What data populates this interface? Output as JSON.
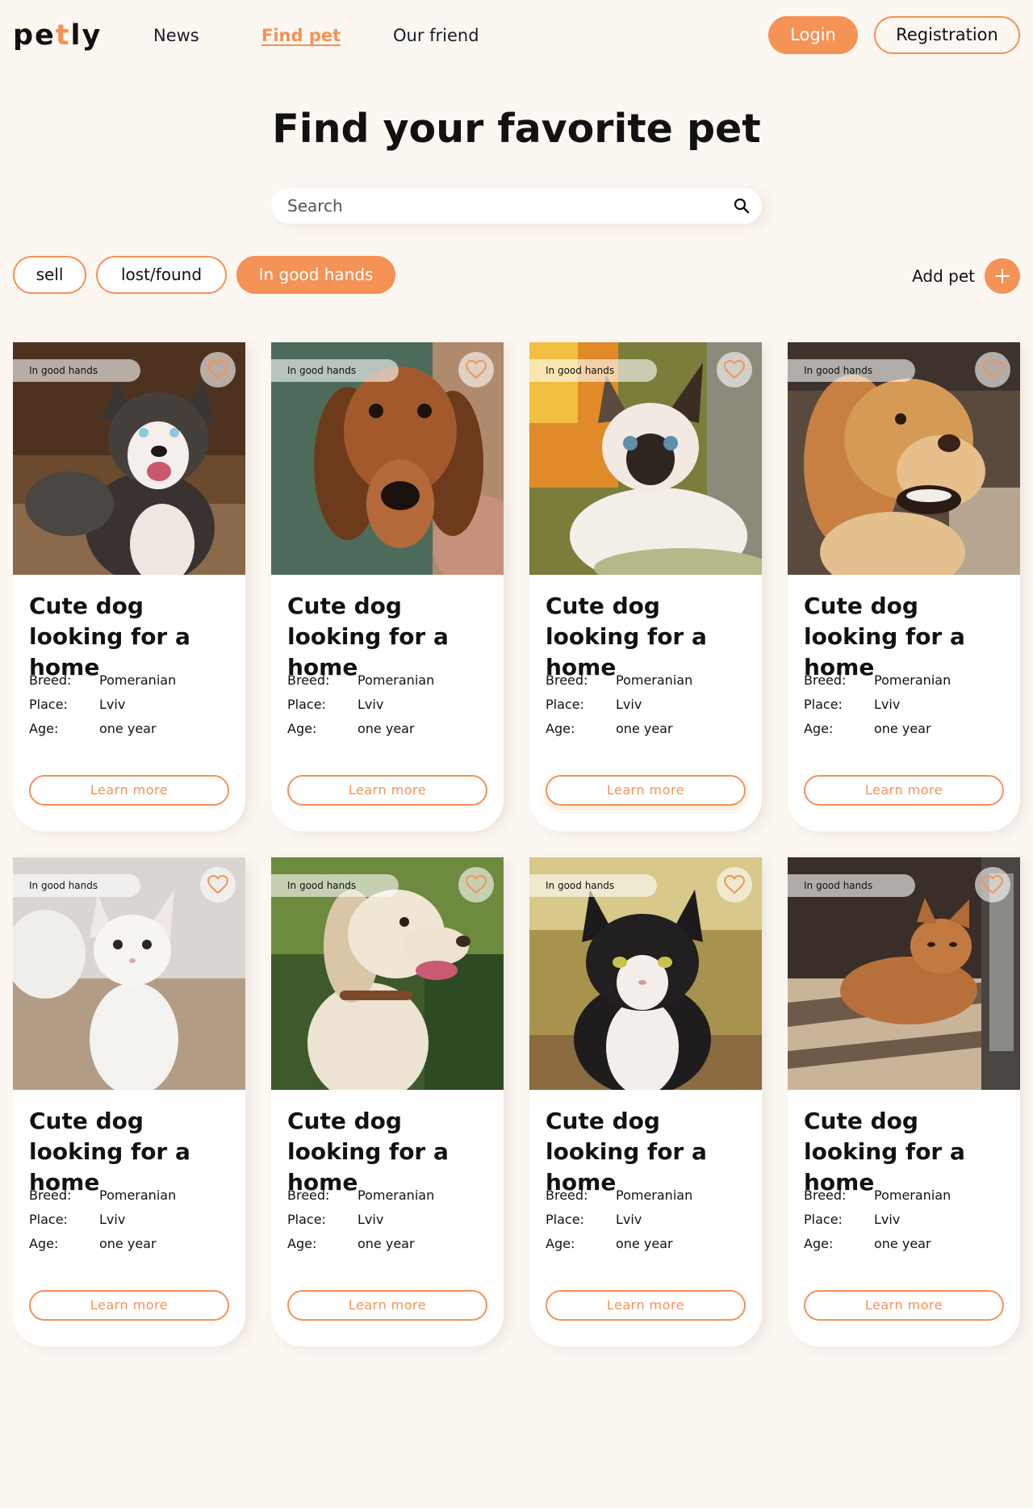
{
  "header": {
    "logo": {
      "part1": "pe",
      "part2": "t",
      "part3": "ly"
    },
    "nav": [
      {
        "label": "News",
        "active": false
      },
      {
        "label": "Find pet",
        "active": true
      },
      {
        "label": "Our friend",
        "active": false
      }
    ],
    "login_label": "Login",
    "register_label": "Registration"
  },
  "main": {
    "title": "Find your favorite pet",
    "search": {
      "placeholder": "Search",
      "value": ""
    },
    "filters": [
      {
        "label": "sell",
        "active": false
      },
      {
        "label": "lost/found",
        "active": false
      },
      {
        "label": "In good hands",
        "active": true
      }
    ],
    "add_pet_label": "Add pet"
  },
  "cards": [
    {
      "badge": "In good hands",
      "title": "Cute dog looking for a home",
      "breed_label": "Breed:",
      "breed": "Pomeranian",
      "place_label": "Place:",
      "place": "Lviv",
      "age_label": "Age:",
      "age": "one year",
      "button": "Learn more",
      "photo": "husky"
    },
    {
      "badge": "In good hands",
      "title": "Cute dog looking for a home",
      "breed_label": "Breed:",
      "breed": "Pomeranian",
      "place_label": "Place:",
      "place": "Lviv",
      "age_label": "Age:",
      "age": "one year",
      "button": "Learn more",
      "photo": "dachshund"
    },
    {
      "badge": "In good hands",
      "title": "Cute dog looking for a home",
      "breed_label": "Breed:",
      "breed": "Pomeranian",
      "place_label": "Place:",
      "place": "Lviv",
      "age_label": "Age:",
      "age": "one year",
      "button": "Learn more",
      "photo": "siamese-kitten"
    },
    {
      "badge": "In good hands",
      "title": "Cute dog looking for a home",
      "breed_label": "Breed:",
      "breed": "Pomeranian",
      "place_label": "Place:",
      "place": "Lviv",
      "age_label": "Age:",
      "age": "one year",
      "button": "Learn more",
      "photo": "golden-retriever"
    },
    {
      "badge": "In good hands",
      "title": "Cute dog looking for a home",
      "breed_label": "Breed:",
      "breed": "Pomeranian",
      "place_label": "Place:",
      "place": "Lviv",
      "age_label": "Age:",
      "age": "one year",
      "button": "Learn more",
      "photo": "white-kitten"
    },
    {
      "badge": "In good hands",
      "title": "Cute dog looking for a home",
      "breed_label": "Breed:",
      "breed": "Pomeranian",
      "place_label": "Place:",
      "place": "Lviv",
      "age_label": "Age:",
      "age": "one year",
      "button": "Learn more",
      "photo": "labrador"
    },
    {
      "badge": "In good hands",
      "title": "Cute dog looking for a home",
      "breed_label": "Breed:",
      "breed": "Pomeranian",
      "place_label": "Place:",
      "place": "Lviv",
      "age_label": "Age:",
      "age": "one year",
      "button": "Learn more",
      "photo": "tuxedo-cat"
    },
    {
      "badge": "In good hands",
      "title": "Cute dog looking for a home",
      "breed_label": "Breed:",
      "breed": "Pomeranian",
      "place_label": "Place:",
      "place": "Lviv",
      "age_label": "Age:",
      "age": "one year",
      "button": "Learn more",
      "photo": "ginger-cat"
    }
  ],
  "colors": {
    "accent": "#F59256",
    "background": "#FDF7F2",
    "card": "#FFFFFF",
    "text": "#111111"
  },
  "icons": {
    "search": "search-icon",
    "favorite": "heart-icon",
    "add": "plus-icon"
  }
}
